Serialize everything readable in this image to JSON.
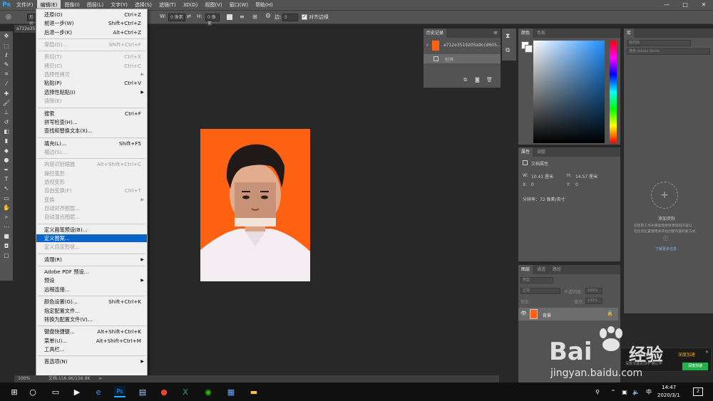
{
  "app": {
    "logo": "Ps"
  },
  "menubar": {
    "items": [
      "文件(F)",
      "编辑(E)",
      "图像(I)",
      "图层(L)",
      "文字(Y)",
      "选择(S)",
      "滤镜(T)",
      "3D(D)",
      "视图(V)",
      "窗口(W)",
      "帮助(H)"
    ],
    "active_index": 1
  },
  "window_controls": {
    "minimize": "—",
    "maximize": "□",
    "close": "✕"
  },
  "options_bar": {
    "w_label": "W:",
    "w_value": "0 像素",
    "h_label": "H:",
    "h_value": "0 像素",
    "edge_label": "边:",
    "edge_value": "5",
    "align_label": "对齐边缘",
    "style_value": "形状"
  },
  "document_tab": {
    "title": "a712e35"
  },
  "edit_menu": {
    "items": [
      {
        "label": "还原(O)",
        "shortcut": "Ctrl+Z",
        "disabled": false
      },
      {
        "label": "前进一步(W)",
        "shortcut": "Shift+Ctrl+Z",
        "disabled": false
      },
      {
        "label": "后退一步(K)",
        "shortcut": "Alt+Ctrl+Z",
        "disabled": false
      },
      {
        "sep": true
      },
      {
        "label": "渐隐(D)...",
        "shortcut": "Shift+Ctrl+F",
        "disabled": true
      },
      {
        "sep": true
      },
      {
        "label": "剪切(T)",
        "shortcut": "Ctrl+X",
        "disabled": true
      },
      {
        "label": "拷贝(C)",
        "shortcut": "Ctrl+C",
        "disabled": true
      },
      {
        "label": "选择性拷贝",
        "shortcut": "",
        "disabled": true,
        "submenu": true
      },
      {
        "label": "粘贴(P)",
        "shortcut": "Ctrl+V",
        "disabled": false
      },
      {
        "label": "选择性粘贴(I)",
        "shortcut": "",
        "disabled": false,
        "submenu": true
      },
      {
        "label": "清除(E)",
        "shortcut": "",
        "disabled": true
      },
      {
        "sep": true
      },
      {
        "label": "搜索",
        "shortcut": "Ctrl+F",
        "disabled": false
      },
      {
        "label": "拼写检查(H)...",
        "shortcut": "",
        "disabled": false
      },
      {
        "label": "查找和替换文本(X)...",
        "shortcut": "",
        "disabled": false
      },
      {
        "sep": true
      },
      {
        "label": "填充(L)...",
        "shortcut": "Shift+F5",
        "disabled": false
      },
      {
        "label": "描边(S)...",
        "shortcut": "",
        "disabled": true
      },
      {
        "sep": true
      },
      {
        "label": "内容识别缩放",
        "shortcut": "Alt+Shift+Ctrl+C",
        "disabled": true
      },
      {
        "label": "操控变形",
        "shortcut": "",
        "disabled": true
      },
      {
        "label": "透视变形",
        "shortcut": "",
        "disabled": true
      },
      {
        "label": "自由变换(F)",
        "shortcut": "Ctrl+T",
        "disabled": true
      },
      {
        "label": "变换",
        "shortcut": "",
        "disabled": true,
        "submenu": true
      },
      {
        "label": "自动对齐图层...",
        "shortcut": "",
        "disabled": true
      },
      {
        "label": "自动混合图层...",
        "shortcut": "",
        "disabled": true
      },
      {
        "sep": true
      },
      {
        "label": "定义画笔预设(B)...",
        "shortcut": "",
        "disabled": false
      },
      {
        "label": "定义图案...",
        "shortcut": "",
        "disabled": false,
        "highlight": true
      },
      {
        "label": "定义自定形状...",
        "shortcut": "",
        "disabled": true
      },
      {
        "sep": true
      },
      {
        "label": "清理(R)",
        "shortcut": "",
        "disabled": false,
        "submenu": true
      },
      {
        "sep": true
      },
      {
        "label": "Adobe PDF 预设...",
        "shortcut": "",
        "disabled": false
      },
      {
        "label": "预设",
        "shortcut": "",
        "disabled": false,
        "submenu": true
      },
      {
        "label": "远程连接...",
        "shortcut": "",
        "disabled": false
      },
      {
        "sep": true
      },
      {
        "label": "颜色设置(G)...",
        "shortcut": "Shift+Ctrl+K",
        "disabled": false
      },
      {
        "label": "指定配置文件...",
        "shortcut": "",
        "disabled": false
      },
      {
        "label": "转换为配置文件(V)...",
        "shortcut": "",
        "disabled": false
      },
      {
        "sep": true
      },
      {
        "label": "键盘快捷键...",
        "shortcut": "Alt+Shift+Ctrl+K",
        "disabled": false
      },
      {
        "label": "菜单(U)...",
        "shortcut": "Alt+Shift+Ctrl+M",
        "disabled": false
      },
      {
        "label": "工具栏...",
        "shortcut": "",
        "disabled": false
      },
      {
        "sep": true
      },
      {
        "label": "首选项(N)",
        "shortcut": "",
        "disabled": false,
        "submenu": true
      }
    ]
  },
  "history_panel": {
    "title": "历史记录",
    "snapshot_name": "a712e3519205a9ccd605...",
    "step_label": "打开"
  },
  "color_panel": {
    "tabs": [
      "颜色",
      "色板"
    ]
  },
  "properties_panel": {
    "tabs": [
      "属性",
      "调整"
    ],
    "section": "文档属性",
    "w_label": "W:",
    "w_value": "10.41 厘米",
    "h_label": "H:",
    "h_value": "14.57 厘米",
    "x_label": "X:",
    "x_value": "0",
    "y_label": "Y:",
    "y_value": "0",
    "resolution": "分辨率：72 像素/英寸"
  },
  "layers_panel": {
    "tabs": [
      "图层",
      "通道",
      "路径"
    ],
    "filter_kind": "类型",
    "blend_mode": "正常",
    "opacity_label": "不透明度:",
    "opacity_value": "100%",
    "lock_label": "锁定:",
    "fill_label": "填充:",
    "fill_value": "100%",
    "layer_name": "背景"
  },
  "library_panel": {
    "title": "库",
    "dropdown": "我的库",
    "search_placeholder": "搜索 Adobe Stock",
    "empty_title": "添加资料",
    "empty_line1": "在您的工作中重复使用资源等的内容以",
    "empty_line2": "在任何位置使用并开始创建内容的新方式。",
    "learn_more": "了解更多信息"
  },
  "status_bar": {
    "zoom": "100%",
    "doc_info": "文档:156.9K/156.9K",
    "arrow": ">"
  },
  "taskbar": {
    "time": "14:47",
    "date": "2020/3/1",
    "ime": "中",
    "notification_count": "2"
  },
  "notification": {
    "title": "Ps 加速",
    "subtitle": "深度加速关闭中 确认中",
    "button": "深度加速",
    "link": "深度加速"
  },
  "watermark": {
    "brand": "Bai",
    "brand2": "经验",
    "url": "jingyan.baidu.com"
  }
}
